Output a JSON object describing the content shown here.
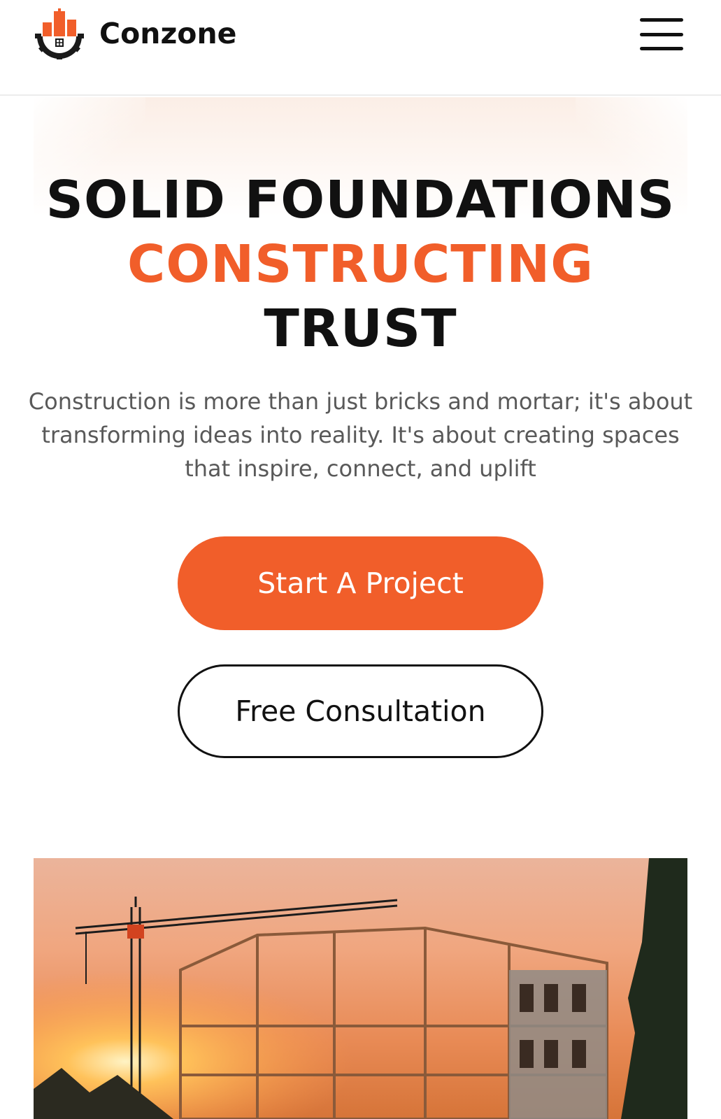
{
  "header": {
    "brand_name": "Conzone",
    "logo_icon": "construction-gear-logo-icon",
    "menu_icon": "hamburger-menu-icon"
  },
  "hero": {
    "headline_line1": "SOLID FOUNDATIONS",
    "headline_line2": "CONSTRUCTING",
    "headline_line3": "TRUST",
    "description": "Construction is more than just bricks and mortar; it's about transforming ideas into reality. It's about creating spaces that inspire, connect, and uplift",
    "primary_button_label": "Start A Project",
    "secondary_button_label": "Free Consultation"
  },
  "colors": {
    "accent": "#f15e2a",
    "text_dark": "#111111",
    "text_muted": "#595959"
  }
}
